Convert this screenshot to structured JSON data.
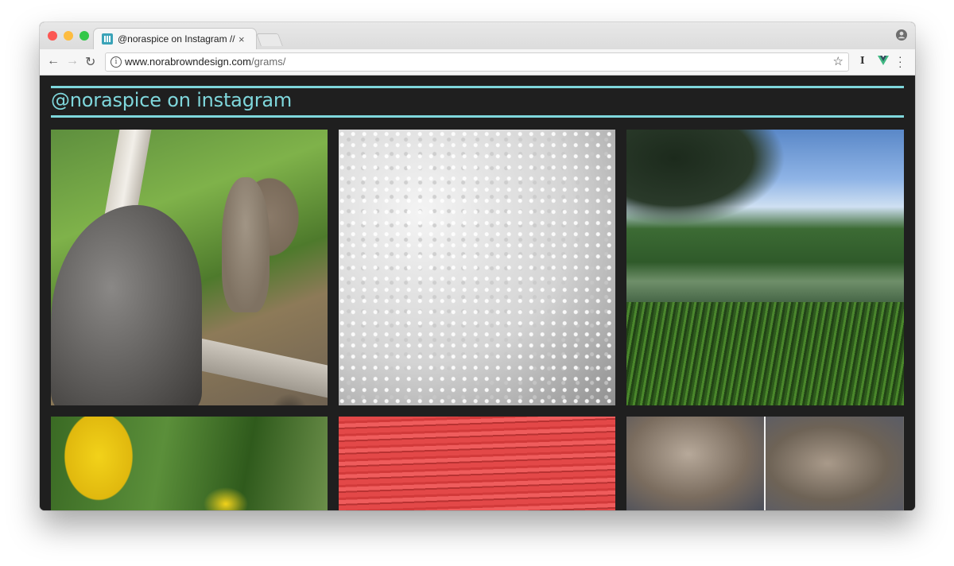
{
  "browser": {
    "tab_title": "@noraspice on Instagram // No",
    "tab_close": "×",
    "url_domain": "www.norabrowndesign.com",
    "url_path": "/grams/",
    "icons": {
      "back": "back-arrow-icon",
      "forward": "forward-arrow-icon",
      "reload": "reload-icon",
      "info": "info-icon",
      "bookmark": "star-icon",
      "profile": "profile-icon",
      "menu": "menu-dots-icon"
    },
    "traffic_lights": [
      "#fc5753",
      "#fdbc40",
      "#33c748"
    ]
  },
  "page": {
    "heading": "@noraspice on instagram",
    "accent_color": "#7fd7dc",
    "background": "#1f1f1f",
    "photos": [
      {
        "name": "cat-and-squirrel-photo"
      },
      {
        "name": "clouds-photo"
      },
      {
        "name": "pond-landscape-photo"
      },
      {
        "name": "yellow-iris-photo"
      },
      {
        "name": "red-wood-photo"
      },
      {
        "name": "sleeping-cats-photo"
      }
    ]
  }
}
